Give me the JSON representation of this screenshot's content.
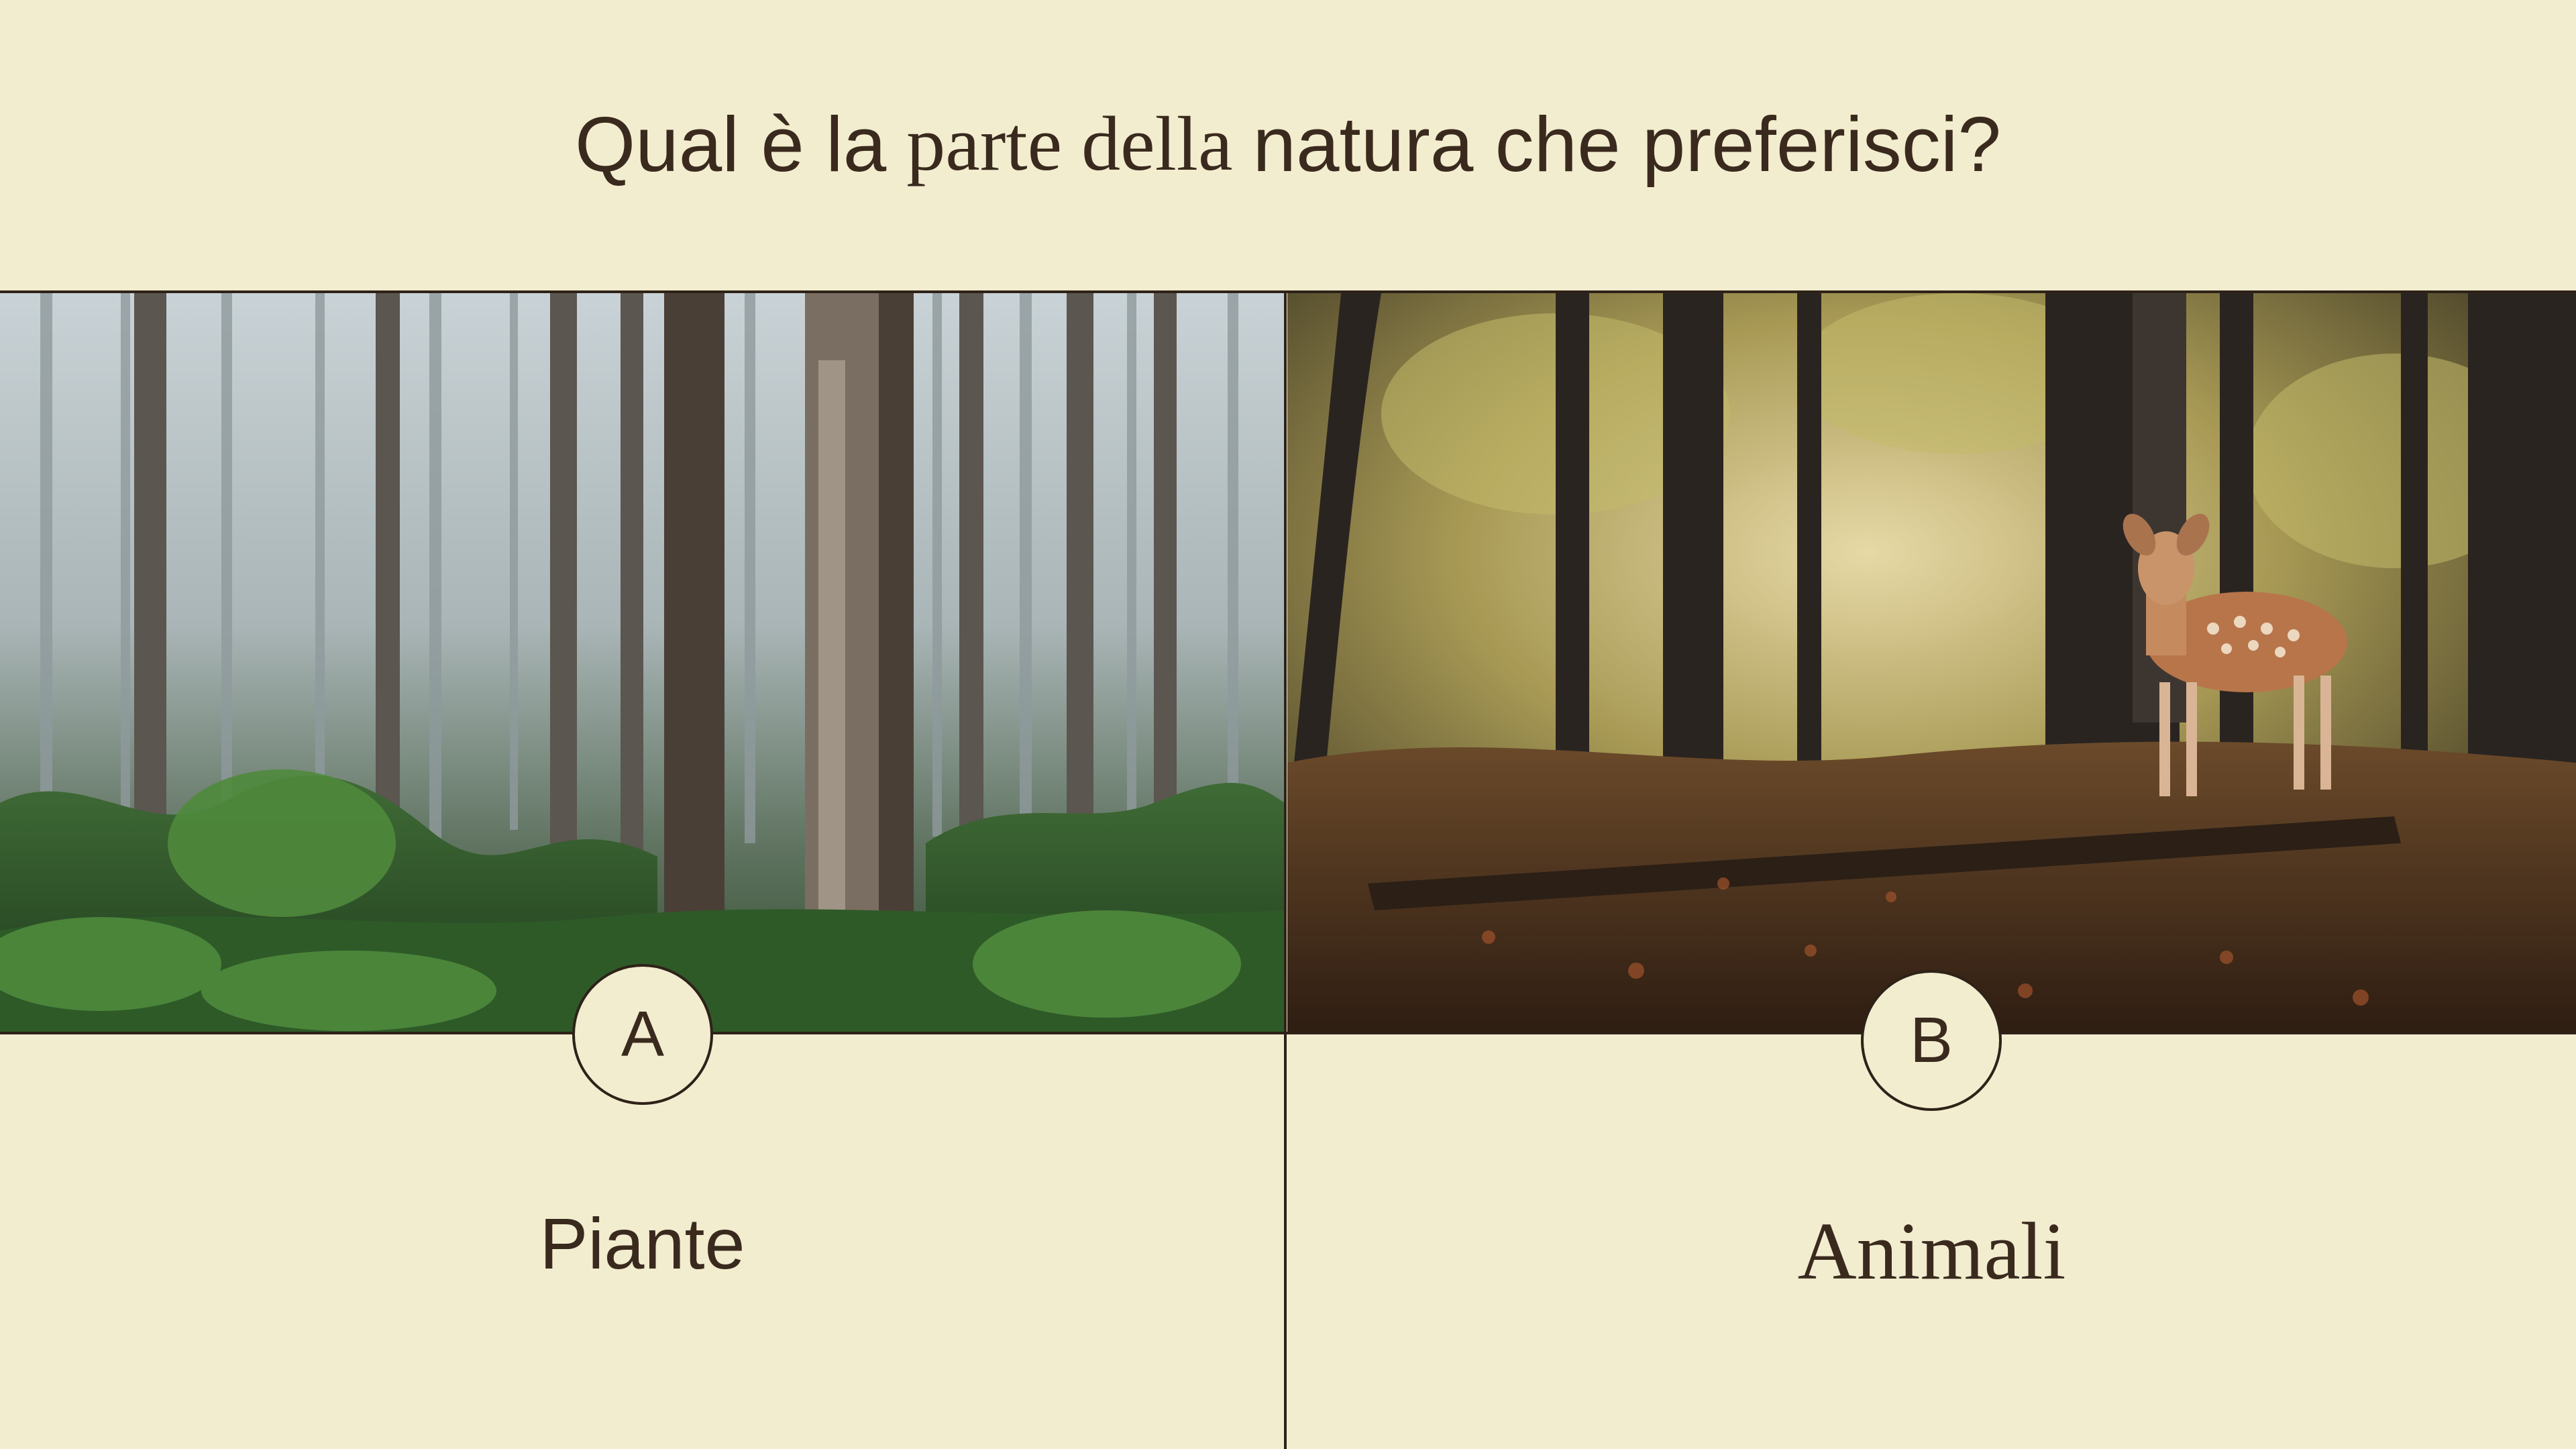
{
  "question": {
    "part1": "Qual è la",
    "part2": "parte della",
    "part3": "natura che preferisci?"
  },
  "options": [
    {
      "letter": "A",
      "label": "Piante",
      "image": "misty-forest-photo"
    },
    {
      "letter": "B",
      "label": "Animali",
      "image": "deer-in-forest-photo"
    }
  ],
  "colors": {
    "background": "#f2edcf",
    "ink": "#3a2a1e"
  }
}
